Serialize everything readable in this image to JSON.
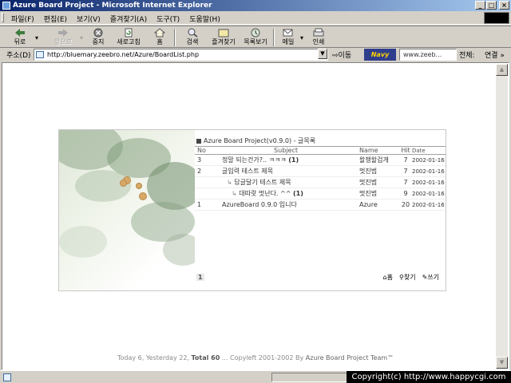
{
  "window": {
    "title": "Azure Board Project - Microsoft Internet Explorer",
    "minimize": "_",
    "maximize": "□",
    "close": "×"
  },
  "menu": [
    "파일(F)",
    "편집(E)",
    "보기(V)",
    "즐겨찾기(A)",
    "도구(T)",
    "도움말(H)"
  ],
  "toolbar": {
    "back": "뒤로",
    "forward": "앞으로",
    "stop": "중지",
    "refresh": "새로고침",
    "home": "홈",
    "search": "검색",
    "favorites": "즐겨찾기",
    "history": "목록보기",
    "mail": "메일",
    "print": "인쇄"
  },
  "address": {
    "label": "주소(D)",
    "url": "http://bluemary.zeebro.net/Azure/BoardList.php",
    "go": "이동",
    "search_value": "www.zeeb...",
    "search_scope": "전체:",
    "links": "연결 »"
  },
  "icons": {
    "back": "arrow-left-icon",
    "forward": "arrow-right-icon",
    "stop": "stop-icon",
    "refresh": "refresh-icon",
    "home": "home-icon",
    "search": "search-icon",
    "favorites": "favorites-icon",
    "history": "history-icon",
    "mail": "mail-icon",
    "print": "print-icon"
  },
  "board": {
    "title": "Azure Board Project(v0.9.0) - 글목록",
    "columns": {
      "no": "No",
      "subject": "Subject",
      "name": "Name",
      "hit": "Hit",
      "date": "Date"
    },
    "rows": [
      {
        "no": "3",
        "subject": "정말 되는건가?.. ㅋㅋㅋ",
        "comments": "(1)",
        "name": "왈챙왈겁개",
        "hit": "7",
        "date": "2002-01-16",
        "depth": 0,
        "reply": ""
      },
      {
        "no": "2",
        "subject": "글입력 테스트 제목",
        "comments": "",
        "name": "멋진범",
        "hit": "7",
        "date": "2002-01-16",
        "depth": 0,
        "reply": ""
      },
      {
        "no": "",
        "subject": "답글달기 테스트 제목",
        "comments": "",
        "name": "멋진범",
        "hit": "7",
        "date": "2002-01-16",
        "depth": 1,
        "reply": "↳"
      },
      {
        "no": "",
        "subject": "대따랏 멋난다. ^^",
        "comments": "(1)",
        "name": "멋진범",
        "hit": "9",
        "date": "2002-01-16",
        "depth": 2,
        "reply": "↳"
      },
      {
        "no": "1",
        "subject": "AzureBoard 0.9.0 입니다",
        "comments": "",
        "name": "Azure",
        "hit": "20",
        "date": "2002-01-16",
        "depth": 0,
        "reply": ""
      }
    ],
    "page": "1",
    "actions": {
      "home": "홈",
      "find": "찾기",
      "write": "쓰기"
    }
  },
  "footer": {
    "today": "Today 6, Yesterday 22,",
    "total": "Total 60",
    "copyleft": "... Copyleft 2001-2002 By",
    "team": "Azure Board Project Team™"
  },
  "status": {
    "copyright": "Copyright(c) http://www.happycgi.com"
  }
}
